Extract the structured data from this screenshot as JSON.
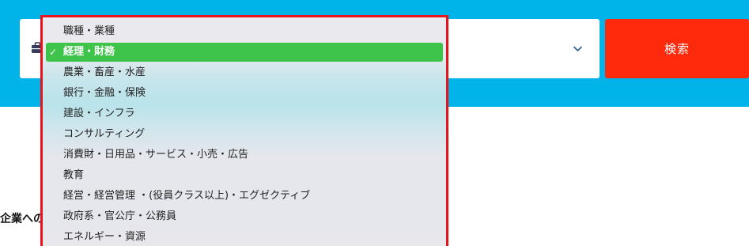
{
  "search": {
    "button_label": "検索"
  },
  "background": {
    "partial_heading": "企業への"
  },
  "dropdown": {
    "selected_index": 1,
    "check_glyph": "✓",
    "options": [
      "職種・業種",
      "経理・財務",
      "農業・畜産・水産",
      "銀行・金融・保険",
      "建設・インフラ",
      "コンサルティング",
      "消費財・日用品・サービス・小売・広告",
      "教育",
      "経営・経営管理 ・(役員クラス以上)・エグゼクティブ",
      "政府系・官公庁・公務員",
      "エネルギー・資源"
    ]
  },
  "colors": {
    "header_band": "#00b3e8",
    "search_button": "#ff2a0c",
    "selected_option": "#3ec44a",
    "dropdown_border": "#e8141b",
    "icon_color": "#333a5c"
  },
  "icons": {
    "select_leading": "briefcase-icon",
    "select_trailing": "chevron-down-icon"
  }
}
